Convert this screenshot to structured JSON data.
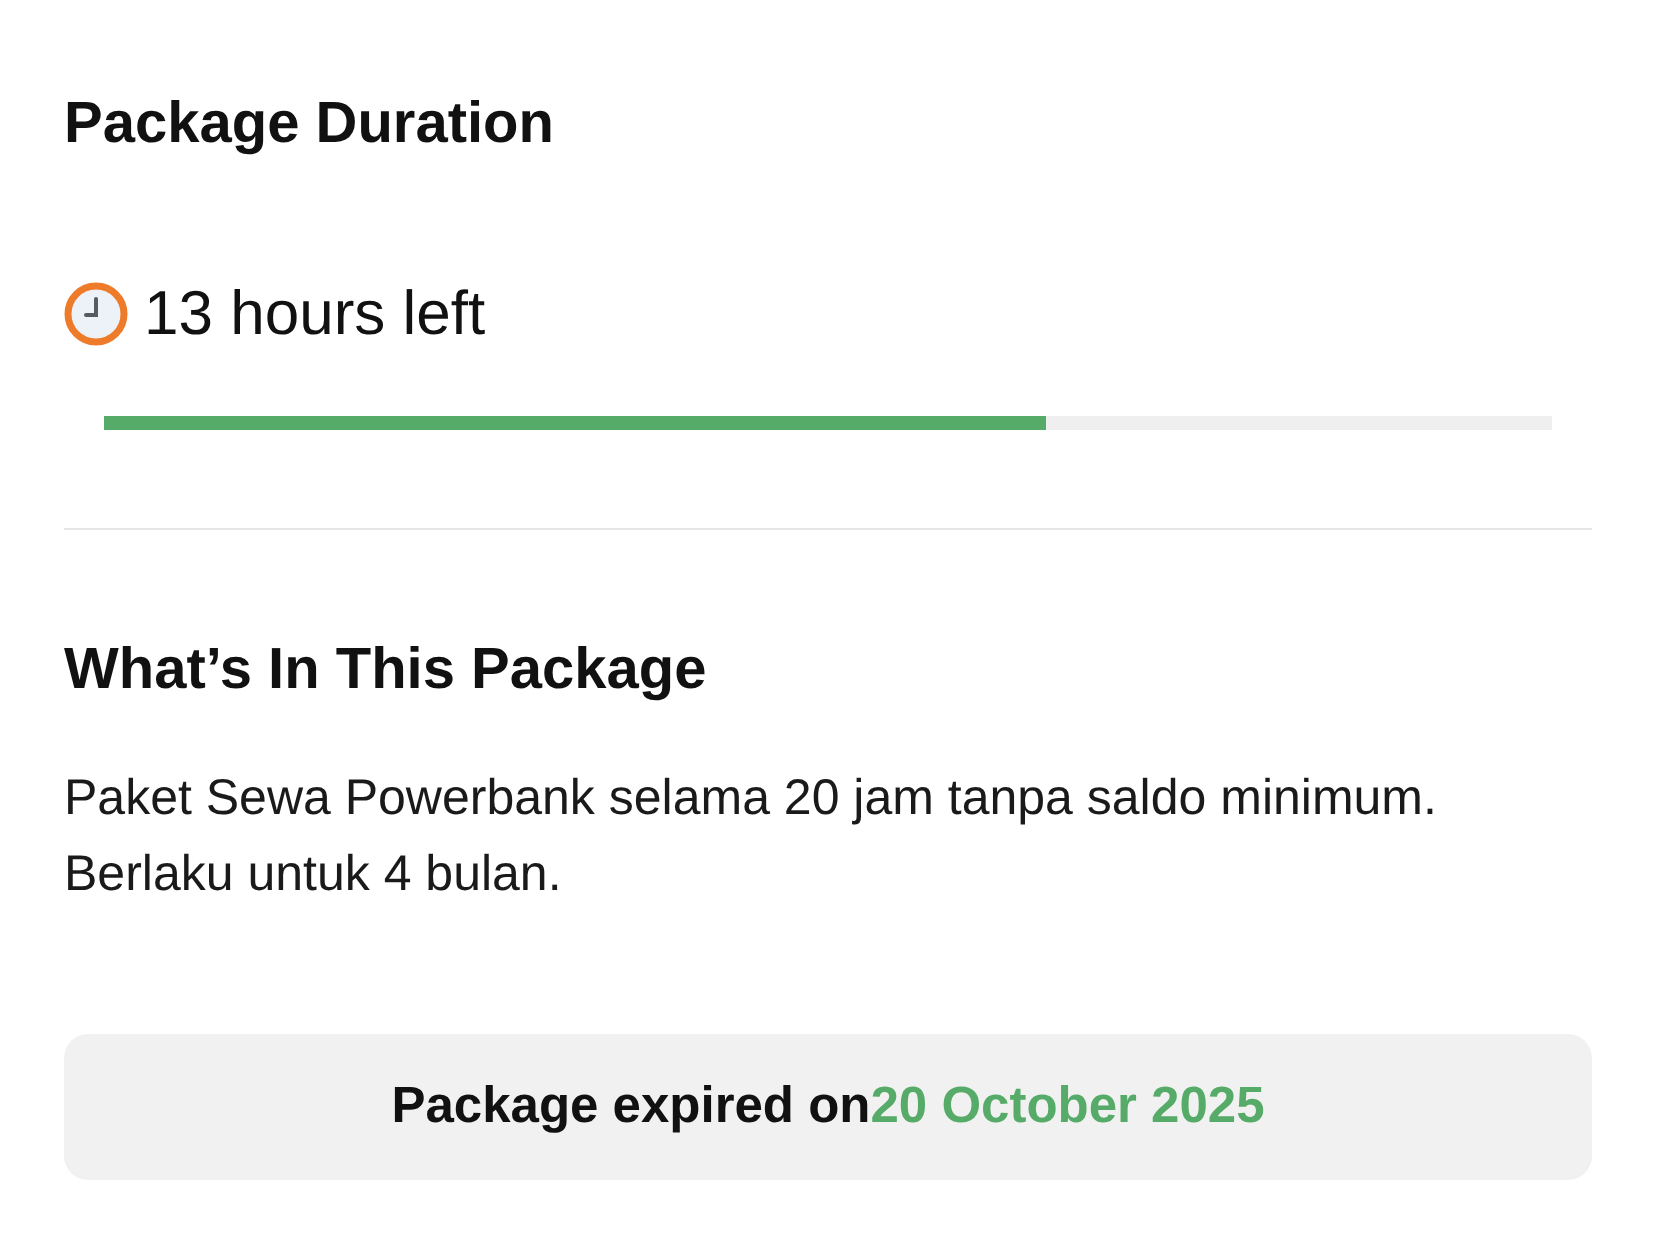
{
  "duration": {
    "title": "Package Duration",
    "remaining": "13 hours left",
    "level": 0.65
  },
  "package": {
    "title": "What’s In This Package",
    "description": "Paket Sewa Powerbank selama 20 jam tanpa saldo minimum. Berlaku untuk 4 bulan."
  },
  "expiry": {
    "label": "Package expired on",
    "date": "20 October 2025"
  }
}
